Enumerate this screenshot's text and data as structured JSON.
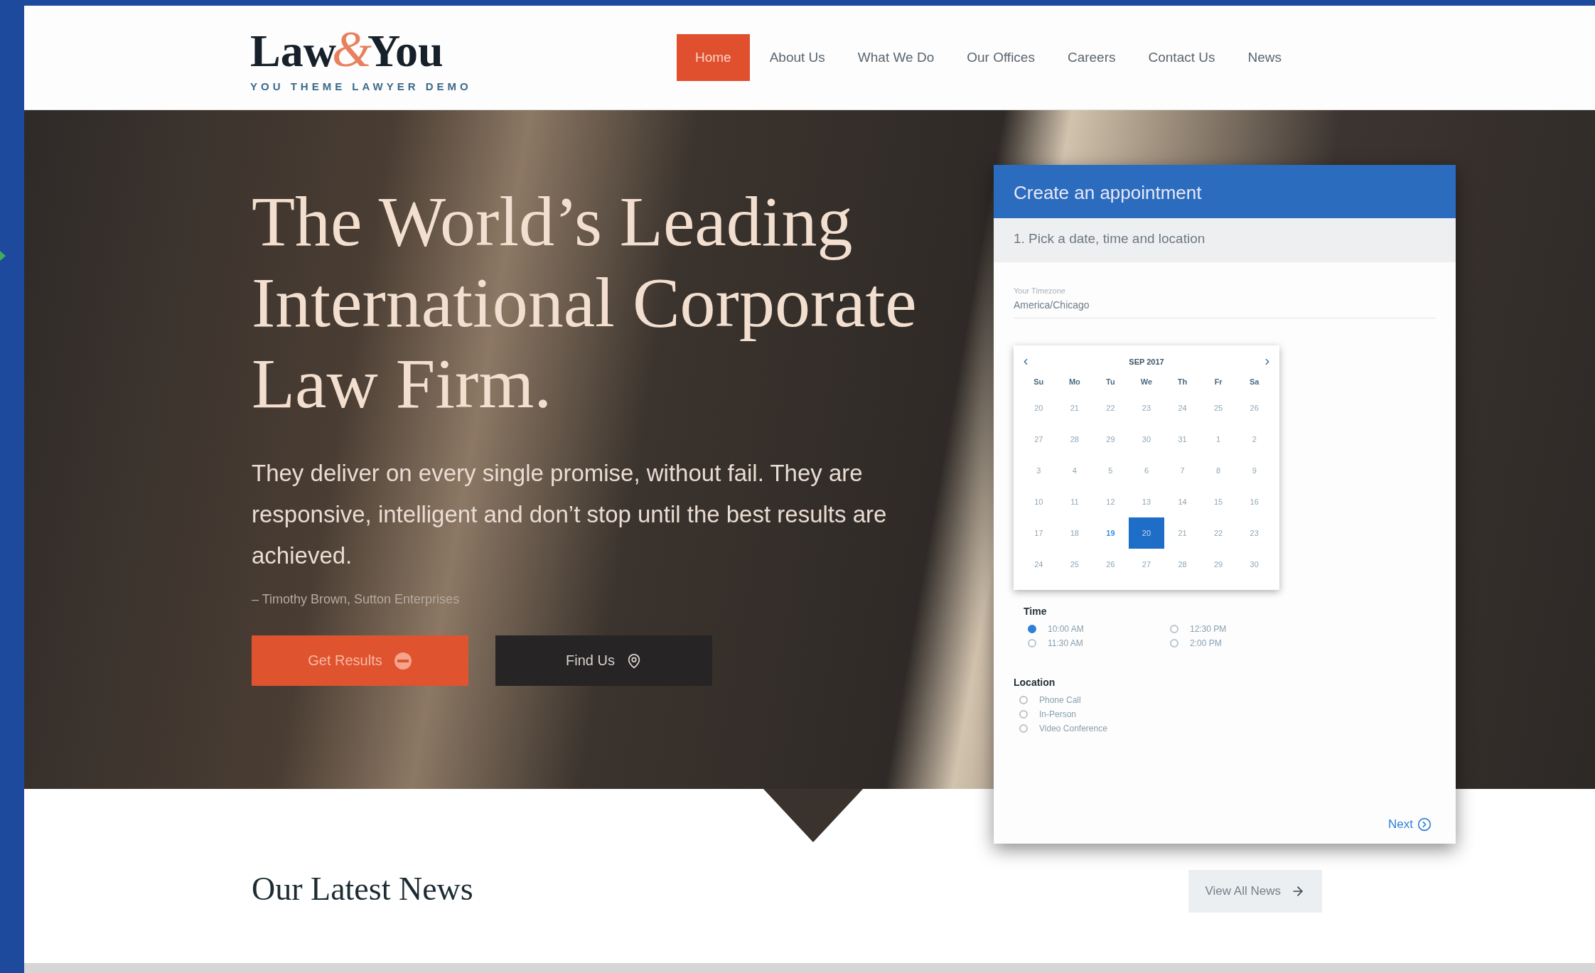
{
  "logo": {
    "parts": [
      "Law",
      "&",
      "You"
    ],
    "tagline": "YOU THEME LAWYER DEMO"
  },
  "nav": [
    {
      "label": "Home",
      "selected": true
    },
    {
      "label": "About Us",
      "selected": false
    },
    {
      "label": "What We Do",
      "selected": false
    },
    {
      "label": "Our Offices",
      "selected": false
    },
    {
      "label": "Careers",
      "selected": false
    },
    {
      "label": "Contact Us",
      "selected": false
    },
    {
      "label": "News",
      "selected": false
    }
  ],
  "hero": {
    "headline": "The World’s Leading International Corporate Law Firm.",
    "quote": "They deliver on every single promise, without fail. They are responsive, intelligent and don’t stop until the best results are achieved.",
    "attribution": "– Timothy Brown, Sutton Enterprises",
    "buttons": [
      {
        "kind": "primary",
        "label": "Get Results"
      },
      {
        "kind": "location",
        "label": "Find Us"
      }
    ]
  },
  "appointment": {
    "title": "Create an appointment",
    "step": "1. Pick a date, time and location",
    "timezone": {
      "label": "Your Timezone",
      "value": "America/Chicago"
    },
    "calendar": {
      "month": "SEP 2017",
      "weekdays": [
        "Su",
        "Mo",
        "Tu",
        "We",
        "Th",
        "Fr",
        "Sa"
      ],
      "weeks": [
        [
          {
            "label": "20",
            "selected": false,
            "today": false
          },
          {
            "label": "21",
            "selected": false,
            "today": false
          },
          {
            "label": "22",
            "selected": false,
            "today": false
          },
          {
            "label": "23",
            "selected": false,
            "today": false
          },
          {
            "label": "24",
            "selected": false,
            "today": false
          },
          {
            "label": "25",
            "selected": false,
            "today": false
          },
          {
            "label": "26",
            "selected": false,
            "today": false
          }
        ],
        [
          {
            "label": "27",
            "selected": false,
            "today": false
          },
          {
            "label": "28",
            "selected": false,
            "today": false
          },
          {
            "label": "29",
            "selected": false,
            "today": false
          },
          {
            "label": "30",
            "selected": false,
            "today": false
          },
          {
            "label": "31",
            "selected": false,
            "today": false
          },
          {
            "label": "1",
            "selected": false,
            "today": false
          },
          {
            "label": "2",
            "selected": false,
            "today": false
          }
        ],
        [
          {
            "label": "3",
            "selected": false,
            "today": false
          },
          {
            "label": "4",
            "selected": false,
            "today": false
          },
          {
            "label": "5",
            "selected": false,
            "today": false
          },
          {
            "label": "6",
            "selected": false,
            "today": false
          },
          {
            "label": "7",
            "selected": false,
            "today": false
          },
          {
            "label": "8",
            "selected": false,
            "today": false
          },
          {
            "label": "9",
            "selected": false,
            "today": false
          }
        ],
        [
          {
            "label": "10",
            "selected": false,
            "today": false
          },
          {
            "label": "11",
            "selected": false,
            "today": false
          },
          {
            "label": "12",
            "selected": false,
            "today": false
          },
          {
            "label": "13",
            "selected": false,
            "today": false
          },
          {
            "label": "14",
            "selected": false,
            "today": false
          },
          {
            "label": "15",
            "selected": false,
            "today": false
          },
          {
            "label": "16",
            "selected": false,
            "today": false
          }
        ],
        [
          {
            "label": "17",
            "selected": false,
            "today": false
          },
          {
            "label": "18",
            "selected": false,
            "today": false
          },
          {
            "label": "19",
            "selected": false,
            "today": true
          },
          {
            "label": "20",
            "selected": true,
            "today": false
          },
          {
            "label": "21",
            "selected": false,
            "today": false
          },
          {
            "label": "22",
            "selected": false,
            "today": false
          },
          {
            "label": "23",
            "selected": false,
            "today": false
          }
        ],
        [
          {
            "label": "24",
            "selected": false,
            "today": false
          },
          {
            "label": "25",
            "selected": false,
            "today": false
          },
          {
            "label": "26",
            "selected": false,
            "today": false
          },
          {
            "label": "27",
            "selected": false,
            "today": false
          },
          {
            "label": "28",
            "selected": false,
            "today": false
          },
          {
            "label": "29",
            "selected": false,
            "today": false
          },
          {
            "label": "30",
            "selected": false,
            "today": false
          }
        ]
      ]
    },
    "time_label": "Time",
    "times": [
      {
        "label": "10:00 AM",
        "selected": true
      },
      {
        "label": "11:30 AM",
        "selected": false
      },
      {
        "label": "12:30 PM",
        "selected": false
      },
      {
        "label": "2:00 PM",
        "selected": false
      }
    ],
    "location_label": "Location",
    "locations": [
      {
        "label": "Phone Call",
        "selected": false
      },
      {
        "label": "In-Person",
        "selected": false
      },
      {
        "label": "Video Conference",
        "selected": false
      }
    ],
    "next": "Next"
  },
  "news": {
    "title": "Our Latest News",
    "button": "View All News"
  }
}
